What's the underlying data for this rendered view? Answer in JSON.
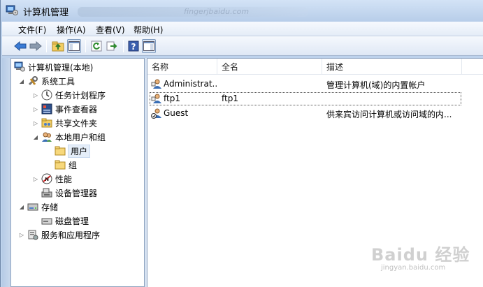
{
  "window": {
    "title": "计算机管理",
    "ghost_url": "fingerjbaidu.com"
  },
  "menu": [
    {
      "label": "文件(F)"
    },
    {
      "label": "操作(A)"
    },
    {
      "label": "查看(V)"
    },
    {
      "label": "帮助(H)"
    }
  ],
  "toolbar": {
    "buttons": [
      "back-arrow-icon",
      "forward-arrow-icon",
      "up-folder-icon",
      "show-hide-tree-icon",
      "refresh-icon",
      "export-icon",
      "help-icon",
      "show-hide-action-pane-icon"
    ]
  },
  "tree": {
    "root": "计算机管理(本地)",
    "system_tools": "系统工具",
    "task_scheduler": "任务计划程序",
    "event_viewer": "事件查看器",
    "shared_folders": "共享文件夹",
    "local_users_groups": "本地用户和组",
    "users": "用户",
    "groups": "组",
    "performance": "性能",
    "device_manager": "设备管理器",
    "storage": "存储",
    "disk_management": "磁盘管理",
    "services_apps": "服务和应用程序"
  },
  "list": {
    "columns": [
      "名称",
      "全名",
      "描述"
    ],
    "rows": [
      {
        "name": "Administrat...",
        "full_name": "",
        "description": "管理计算机(域)的内置帐户"
      },
      {
        "name": "ftp1",
        "full_name": "ftp1",
        "description": ""
      },
      {
        "name": "Guest",
        "full_name": "",
        "description": "供来宾访问计算机或访问域的内..."
      }
    ]
  },
  "watermark": {
    "brand": "Baidu 经验",
    "url": "jingyan.baidu.com"
  }
}
